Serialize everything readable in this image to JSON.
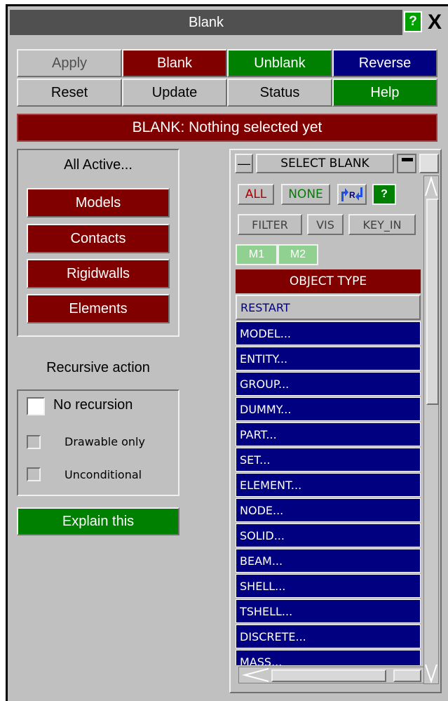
{
  "window": {
    "title": "Blank",
    "help_icon": "?",
    "close_icon": "X"
  },
  "actions": {
    "apply": "Apply",
    "blank": "Blank",
    "unblank": "Unblank",
    "reverse": "Reverse",
    "reset": "Reset",
    "update": "Update",
    "status": "Status",
    "help": "Help"
  },
  "status_message": "BLANK: Nothing selected yet",
  "all_active": {
    "title": "All Active...",
    "buttons": [
      "Models",
      "Contacts",
      "Rigidwalls",
      "Elements"
    ]
  },
  "recursive": {
    "title": "Recursive action",
    "options": [
      "No recursion",
      "Drawable only",
      "Unconditional"
    ],
    "selected": "No recursion"
  },
  "explain": "Explain this",
  "select_panel": {
    "minus_label": "—",
    "title": "SELECT BLANK",
    "filter_row1": [
      "ALL",
      "NONE",
      "R",
      "?"
    ],
    "filter_row2": [
      "FILTER",
      "VIS",
      "KEY_IN"
    ],
    "model_tabs": [
      "M1",
      "M2"
    ],
    "object_type_header": "OBJECT TYPE",
    "restart": "RESTART",
    "items": [
      "MODEL...",
      "ENTITY...",
      "GROUP...",
      "DUMMY...",
      "PART...",
      "SET...",
      "ELEMENT...",
      "NODE...",
      "SOLID...",
      "BEAM...",
      "SHELL...",
      "TSHELL...",
      "DISCRETE...",
      "MASS..."
    ]
  },
  "colors": {
    "panel": "#c0c0c0",
    "red": "#800000",
    "green": "#008000",
    "navy": "#000080"
  }
}
